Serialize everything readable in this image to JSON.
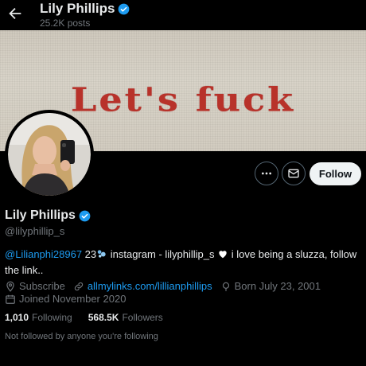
{
  "header": {
    "name": "Lily Phillips",
    "posts_count": "25.2K posts"
  },
  "banner": {
    "text": "Let's fuck"
  },
  "actions": {
    "follow_label": "Follow"
  },
  "profile": {
    "name": "Lily Phillips",
    "handle": "@lilyphillip_s",
    "bio": {
      "mention": "@Lilianphi28967",
      "text_1": " 23",
      "text_2": " instagram - lilyphillip_s ",
      "text_3": " i love being a sluzza, follow the link.."
    },
    "meta": {
      "subscribe": "Subscribe",
      "link": "allmylinks.com/lillianphillips",
      "born": "Born July 23, 2001",
      "joined": "Joined November 2020"
    },
    "stats": {
      "following_count": "1,010",
      "following_label": "Following",
      "followers_count": "568.5K",
      "followers_label": "Followers"
    },
    "not_followed": "Not followed by anyone you're following"
  },
  "colors": {
    "accent": "#1d9bf0",
    "background": "#000000",
    "muted": "#71767b",
    "banner_text": "#b8322a"
  },
  "icons": [
    "back-arrow-icon",
    "verified-badge-icon",
    "more-icon",
    "mail-icon",
    "location-icon",
    "link-icon",
    "birthday-icon",
    "calendar-icon",
    "sparkles-icon",
    "heart-icon"
  ]
}
